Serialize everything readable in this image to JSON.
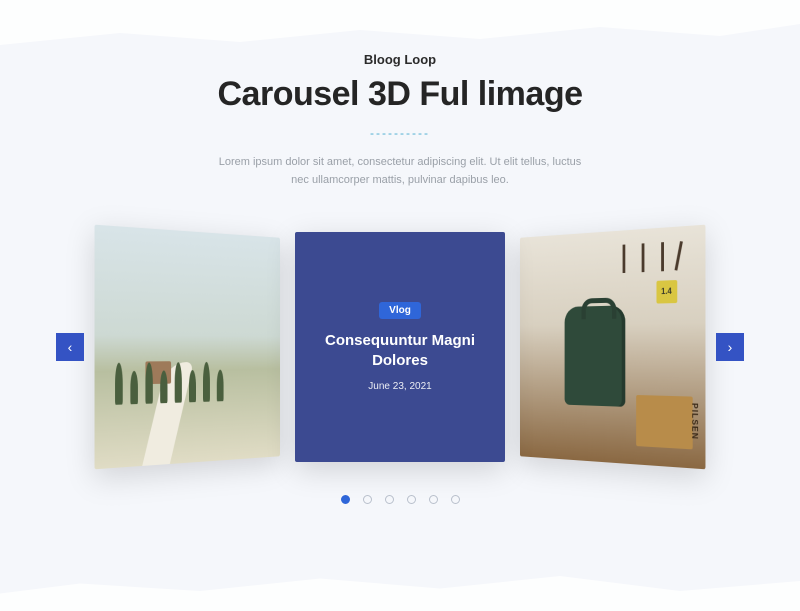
{
  "header": {
    "eyebrow": "Bloog Loop",
    "title": "Carousel 3D Ful limage",
    "divider": "----------",
    "description": "Lorem ipsum dolor sit amet, consectetur adipiscing elit. Ut elit tellus, luctus nec ullamcorper mattis, pulvinar dapibus leo."
  },
  "carousel": {
    "active_index": 0,
    "dot_count": 6,
    "prev_glyph": "‹",
    "next_glyph": "›",
    "center_card": {
      "category": "Vlog",
      "title": "Consequuntur Magni Dolores",
      "date": "June 23, 2021"
    },
    "right_card": {
      "crate_text": "PILSEN",
      "badge_text": "1.4"
    }
  },
  "colors": {
    "accent_nav": "#3453c4",
    "card_bg": "#3c4a91",
    "category_bg": "#2f66d9",
    "divider": "#4daed0"
  }
}
